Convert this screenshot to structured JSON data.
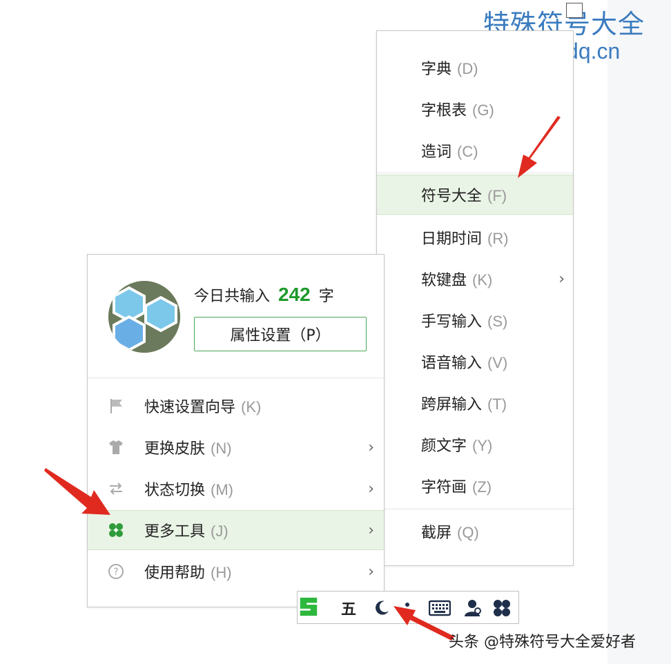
{
  "watermark": {
    "title": "特殊符号大全",
    "url": "www.tsfhdq.cn"
  },
  "main_menu": {
    "today_prefix": "今日共输入",
    "today_count": "242",
    "today_suffix": "字",
    "properties_button": "属性设置（P）",
    "items": [
      {
        "label": "快速设置向导",
        "key": "(K)",
        "icon": "flag-icon",
        "submenu": false
      },
      {
        "label": "更换皮肤",
        "key": "(N)",
        "icon": "tshirt-icon",
        "submenu": true
      },
      {
        "label": "状态切换",
        "key": "(M)",
        "icon": "switch-arrows-icon",
        "submenu": true
      },
      {
        "label": "更多工具",
        "key": "(J)",
        "icon": "clover-icon",
        "submenu": true,
        "active": true
      },
      {
        "label": "使用帮助",
        "key": "(H)",
        "icon": "help-circle-icon",
        "submenu": true
      }
    ]
  },
  "sub_menu": {
    "items": [
      {
        "label": "字典",
        "key": "(D)"
      },
      {
        "label": "字根表",
        "key": "(G)"
      },
      {
        "label": "造词",
        "key": "(C)"
      },
      {
        "label": "符号大全",
        "key": "(F)",
        "active": true
      },
      {
        "label": "日期时间",
        "key": "(R)"
      },
      {
        "label": "软键盘",
        "key": "(K)",
        "submenu": true
      },
      {
        "label": "手写输入",
        "key": "(S)"
      },
      {
        "label": "语音输入",
        "key": "(V)"
      },
      {
        "label": "跨屏输入",
        "key": "(T)"
      },
      {
        "label": "颜文字",
        "key": "(Y)"
      },
      {
        "label": "字符画",
        "key": "(Z)"
      },
      {
        "label": "截屏",
        "key": "(Q)"
      }
    ]
  },
  "status_bar": {
    "wubi_label": "五",
    "icons": [
      "logo-icon",
      "moon-icon",
      "punctuation-icon",
      "keyboard-icon",
      "user-icon",
      "toolbox-icon"
    ]
  },
  "credit": "头条 @特殊符号大全爱好者",
  "colors": {
    "accent_green": "#1e9a2c",
    "active_bg": "#eaf4e6",
    "watermark_blue": "#3a7bbf",
    "arrow_red": "#e02a1f"
  }
}
